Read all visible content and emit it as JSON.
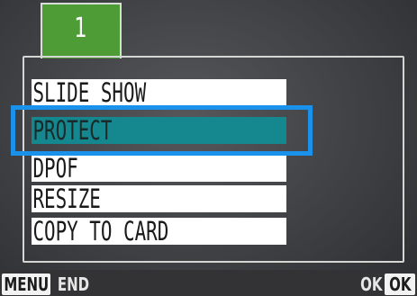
{
  "tab": {
    "label": "1"
  },
  "menu": {
    "items": [
      {
        "label": "SLIDE SHOW",
        "selected": false
      },
      {
        "label": "PROTECT",
        "selected": true
      },
      {
        "label": "DPOF",
        "selected": false
      },
      {
        "label": "RESIZE",
        "selected": false
      },
      {
        "label": "COPY TO CARD",
        "selected": false
      }
    ]
  },
  "footer": {
    "menu_badge": "MENU",
    "end_label": "END",
    "ok_label": "OK",
    "ok_badge": "OK"
  },
  "colors": {
    "tab": "#4e9c35",
    "selected_item": "#15878e",
    "highlight_frame": "#1a91ea"
  }
}
